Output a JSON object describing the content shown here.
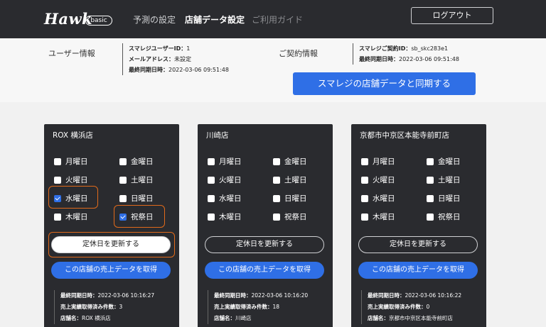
{
  "header": {
    "logo": "Hawk",
    "logo_badge": "basic",
    "nav": [
      "予測の設定",
      "店舗データ設定",
      "ご利用ガイド"
    ],
    "logout": "ログアウト"
  },
  "user_info": {
    "title": "ユーザー情報",
    "id_label": "スマレジユーザーID：",
    "id_value": "1",
    "mail_label": "メールアドレス：",
    "mail_value": "未設定",
    "sync_label": "最終同期日時：",
    "sync_value": "2022-03-06 09:51:48"
  },
  "contract_info": {
    "title": "ご契約情報",
    "contract_label": "スマレジご契約ID：",
    "contract_value": "sb_skc283e1",
    "sync_label": "最終同期日時：",
    "sync_value": "2022-03-06 09:51:48"
  },
  "sync_button": "スマレジの店舗データと同期する",
  "days": [
    "月曜日",
    "火曜日",
    "水曜日",
    "木曜日",
    "金曜日",
    "土曜日",
    "日曜日",
    "祝祭日"
  ],
  "update_button": "定休日を更新する",
  "sales_button": "この店舗の売上データを取得",
  "labels": {
    "last_sync": "最終同期日時：",
    "count": "売上実績取得済み件数：",
    "store_name": "店舗名："
  },
  "stores": [
    {
      "name": "ROX 横浜店",
      "last_sync": "2022-03-06 10:16:27",
      "count": "3",
      "store_name": "ROX 横浜店"
    },
    {
      "name": "川崎店",
      "last_sync": "2022-03-06 10:16:20",
      "count": "18",
      "store_name": "川崎店"
    },
    {
      "name": "京都市中京区本能寺前町店",
      "last_sync": "2022-03-06 10:16:22",
      "count": "0",
      "store_name": "京都市中京区本能寺前町店"
    }
  ],
  "colors": {
    "header_bg": "#2a2b2f",
    "accent": "#2f6fe6",
    "highlight": "#e06a1b"
  }
}
